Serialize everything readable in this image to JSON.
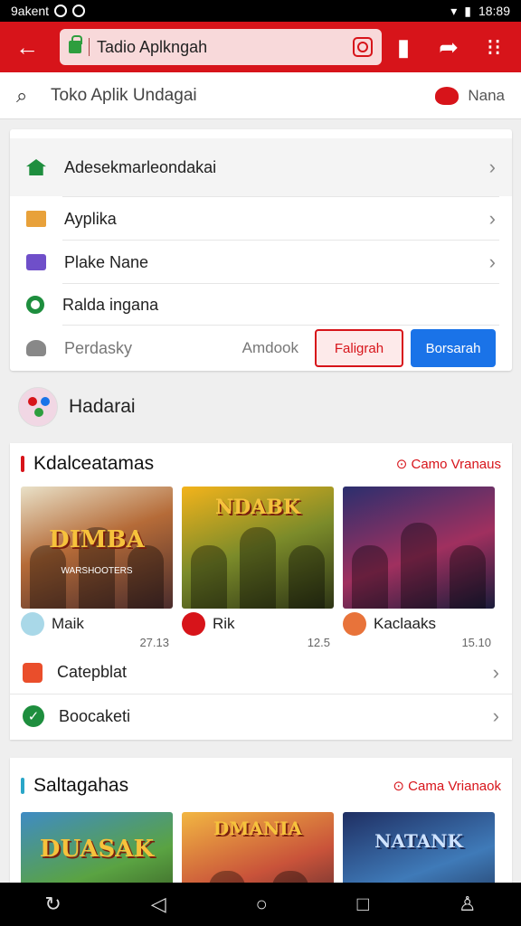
{
  "status_bar": {
    "left_text": "9akent",
    "time": "18:89"
  },
  "toolbar": {
    "back_icon": "arrow-left-icon",
    "url_text": "Tadio Aplkngah",
    "accent": "#d7141a"
  },
  "search": {
    "placeholder": "Toko Aplik Undagai",
    "login_label": "Nana"
  },
  "menu": {
    "items": [
      {
        "label": "Adesekmarleondakai",
        "icon": "home-icon"
      },
      {
        "label": "Ayplika",
        "icon": "apps-icon"
      },
      {
        "label": "Plake Nane",
        "icon": "movies-icon"
      },
      {
        "label": "Ralda ingana",
        "icon": "wishlist-icon"
      }
    ],
    "account_label": "Perdasky",
    "account_link": "Amdook",
    "outline_button": "Faligrah",
    "primary_button": "Borsarah"
  },
  "profile": {
    "name": "Hadarai"
  },
  "section1": {
    "title": "Kdalceatamas",
    "more": "Camo Vranaus",
    "bar_color": "#d7141a",
    "tiles": [
      {
        "art_title": "DIMBA",
        "art_sub": "WARSHOOTERS",
        "name": "Maik",
        "size": "27.13"
      },
      {
        "art_title": "NDABK",
        "art_sub": "",
        "name": "Rik",
        "size": "12.5"
      },
      {
        "art_title": "",
        "art_sub": "",
        "name": "Kaclaaks",
        "size": "15.10"
      }
    ],
    "rows": [
      {
        "label": "Catepblat"
      },
      {
        "label": "Boocaketi"
      }
    ]
  },
  "section2": {
    "title": "Saltagahas",
    "more": "Cama Vrianaok",
    "bar_color": "#2aa6c8",
    "tiles": [
      {
        "art_title": "DUASAK"
      },
      {
        "art_title": "DMANIA"
      },
      {
        "art_title": "NATANK"
      }
    ]
  }
}
